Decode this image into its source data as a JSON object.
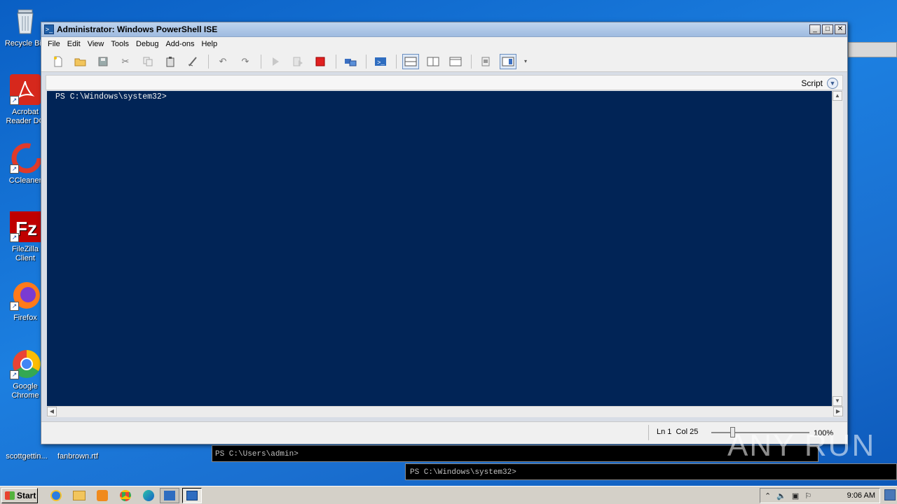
{
  "desktop": {
    "icons": [
      {
        "label": "Recycle Bin"
      },
      {
        "label": "Acrobat Reader DC"
      },
      {
        "label": "CCleaner"
      },
      {
        "label": "FileZilla Client"
      },
      {
        "label": "Firefox"
      },
      {
        "label": "Google Chrome"
      },
      {
        "label": "scottgettin..."
      },
      {
        "label": "fanbrown.rtf"
      }
    ]
  },
  "background_windows": {
    "console1": "PS C:\\Users\\admin>",
    "console2": "PS C:\\Windows\\system32>"
  },
  "window": {
    "title": "Administrator: Windows PowerShell ISE",
    "controls": {
      "minimize": "_",
      "maximize": "□",
      "close": "✕"
    }
  },
  "menu": [
    "File",
    "Edit",
    "View",
    "Tools",
    "Debug",
    "Add-ons",
    "Help"
  ],
  "toolbar": {
    "icons": [
      "new-icon",
      "open-icon",
      "save-icon",
      "cut-icon",
      "copy-icon",
      "paste-icon",
      "clear-icon",
      "undo-icon",
      "redo-icon",
      "run-icon",
      "run-selection-icon",
      "stop-icon",
      "remote-icon",
      "powershell-icon",
      "layout-top-icon",
      "layout-right-icon",
      "layout-max-icon",
      "show-commands-icon",
      "addon-pane-icon"
    ]
  },
  "panel": {
    "label": "Script"
  },
  "console": {
    "prompt": "PS C:\\Windows\\system32>"
  },
  "status": {
    "position": "Ln 1  Col 25",
    "zoom": "100%",
    "zoom_level": 0.22
  },
  "taskbar": {
    "start": "Start",
    "clock": "9:06 AM"
  },
  "watermark": "ANY RUN",
  "colors": {
    "console_bg": "#012456",
    "desktop_bg": "#1c7fe0"
  }
}
